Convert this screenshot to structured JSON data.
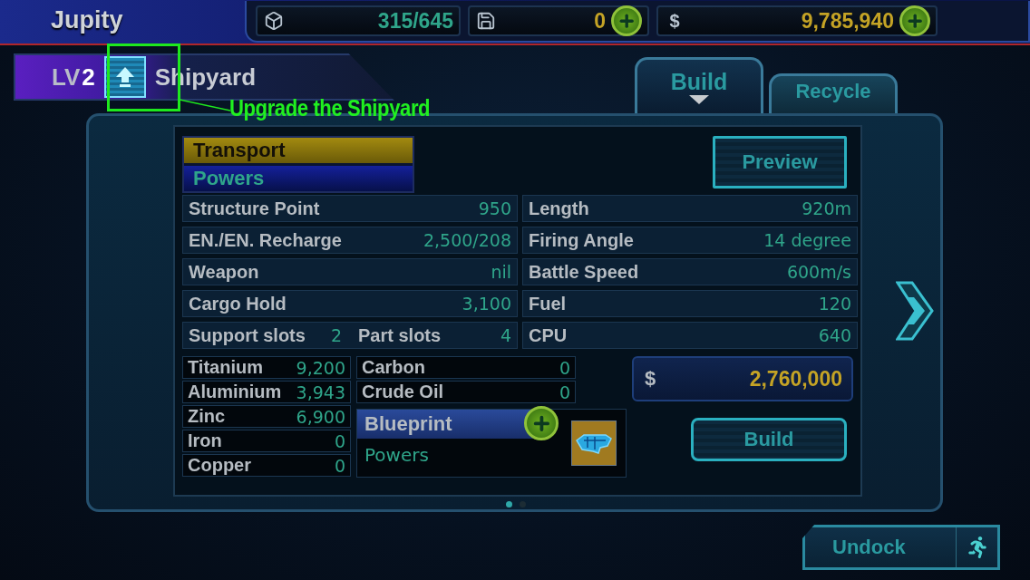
{
  "header": {
    "title": "Jupity"
  },
  "resources": [
    {
      "kind": "cargo",
      "value": "315/645",
      "addable": false
    },
    {
      "kind": "disk",
      "value": "0",
      "addable": true
    },
    {
      "kind": "money",
      "symbol": "$",
      "value": "9,785,940",
      "addable": true
    }
  ],
  "building": {
    "level_label": "LV",
    "level": "2",
    "name": "Shipyard"
  },
  "tooltip": "Upgrade the Shipyard",
  "tabs": [
    {
      "label": "Build",
      "selected": true
    },
    {
      "label": "Recycle",
      "selected": false
    }
  ],
  "ship_list": [
    {
      "label": "Transport",
      "selected": true
    },
    {
      "label": "Powers",
      "selected": false
    }
  ],
  "preview_button": "Preview",
  "stats_left": [
    {
      "label": "Structure Point",
      "value": "950"
    },
    {
      "label": "EN./EN. Recharge",
      "value": "2,500/208"
    },
    {
      "label": "Weapon",
      "value": "nil"
    },
    {
      "label": "Cargo Hold",
      "value": "3,100"
    }
  ],
  "slots": [
    {
      "label": "Support slots",
      "value": "2"
    },
    {
      "label": "Part slots",
      "value": "4"
    }
  ],
  "stats_right": [
    {
      "label": "Length",
      "value": "920m"
    },
    {
      "label": "Firing Angle",
      "value": "14 degree"
    },
    {
      "label": "Battle Speed",
      "value": "600m/s"
    },
    {
      "label": "Fuel",
      "value": "120"
    },
    {
      "label": "CPU",
      "value": "640"
    }
  ],
  "materials_left": [
    {
      "label": "Titanium",
      "value": "9,200"
    },
    {
      "label": "Aluminium",
      "value": "3,943"
    },
    {
      "label": "Zinc",
      "value": "6,900"
    },
    {
      "label": "Iron",
      "value": "0"
    },
    {
      "label": "Copper",
      "value": "0"
    }
  ],
  "materials_right": [
    {
      "label": "Carbon",
      "value": "0"
    },
    {
      "label": "Crude Oil",
      "value": "0"
    }
  ],
  "blueprint": {
    "title": "Blueprint",
    "name": "Powers"
  },
  "cost": {
    "symbol": "$",
    "value": "2,760,000"
  },
  "build_button": "Build",
  "pages": [
    {
      "selected": true
    },
    {
      "selected": false
    }
  ],
  "undock_button": "Undock"
}
